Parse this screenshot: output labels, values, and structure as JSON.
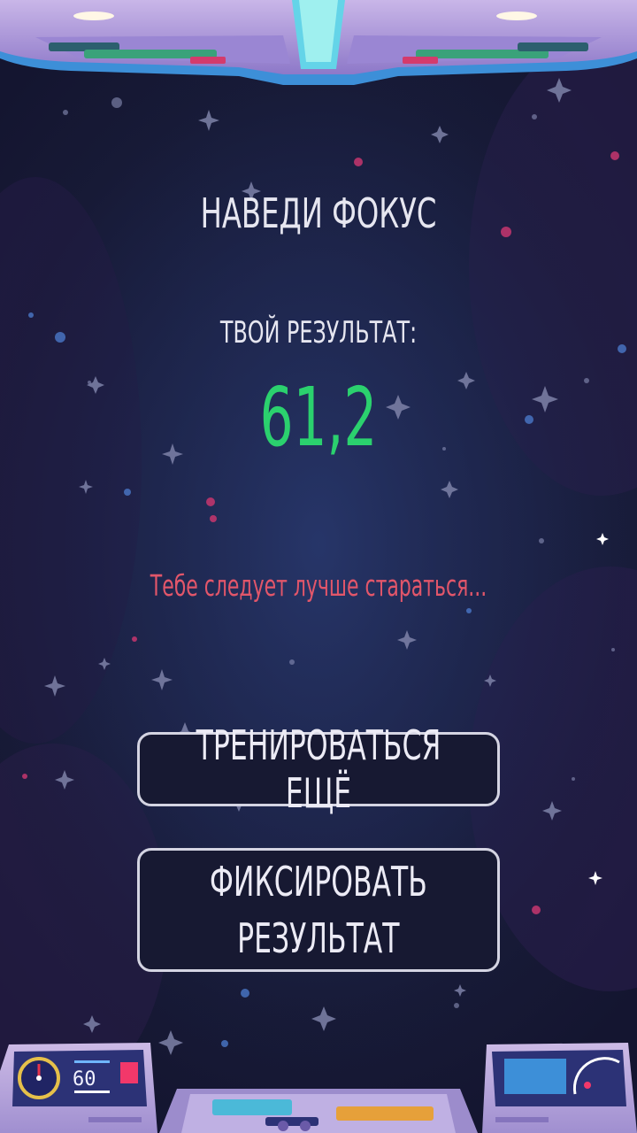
{
  "game": {
    "title": "НАВЕДИ ФОКУС",
    "result_label": "ТВОЙ РЕЗУЛЬТАТ:",
    "result_value": "61,2",
    "feedback": "Тебе следует лучше стараться..."
  },
  "buttons": {
    "train_again": "ТРЕНИРОВАТЬСЯ ЕЩЁ",
    "fix_result": "ФИКСИРОВАТЬ\nРЕЗУЛЬТАТ"
  },
  "hud": {
    "speed_readout": "60"
  },
  "colors": {
    "score": "#2bd16e",
    "feedback": "#e2566a",
    "text": "#e6e6f0",
    "button_border": "#d4d4e2",
    "background": "#1d2449"
  }
}
